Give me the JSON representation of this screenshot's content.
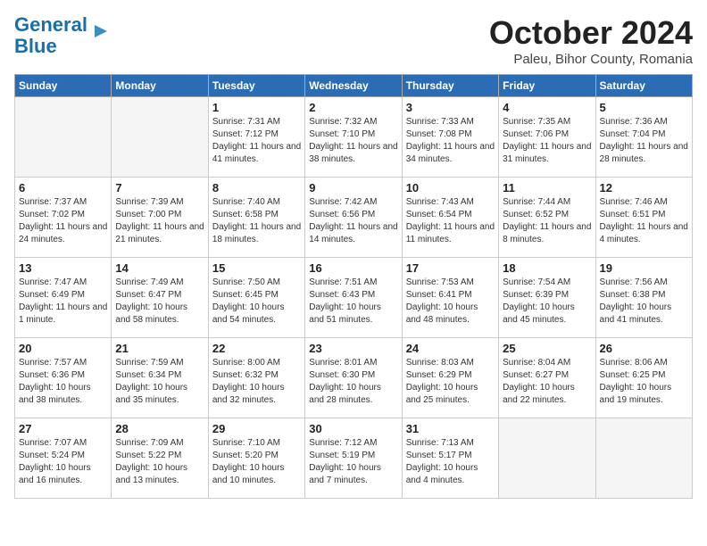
{
  "header": {
    "logo_general": "General",
    "logo_blue": "Blue",
    "month": "October 2024",
    "location": "Paleu, Bihor County, Romania"
  },
  "days_of_week": [
    "Sunday",
    "Monday",
    "Tuesday",
    "Wednesday",
    "Thursday",
    "Friday",
    "Saturday"
  ],
  "weeks": [
    [
      {
        "day": "",
        "content": ""
      },
      {
        "day": "",
        "content": ""
      },
      {
        "day": "1",
        "content": "Sunrise: 7:31 AM\nSunset: 7:12 PM\nDaylight: 11 hours and 41 minutes."
      },
      {
        "day": "2",
        "content": "Sunrise: 7:32 AM\nSunset: 7:10 PM\nDaylight: 11 hours and 38 minutes."
      },
      {
        "day": "3",
        "content": "Sunrise: 7:33 AM\nSunset: 7:08 PM\nDaylight: 11 hours and 34 minutes."
      },
      {
        "day": "4",
        "content": "Sunrise: 7:35 AM\nSunset: 7:06 PM\nDaylight: 11 hours and 31 minutes."
      },
      {
        "day": "5",
        "content": "Sunrise: 7:36 AM\nSunset: 7:04 PM\nDaylight: 11 hours and 28 minutes."
      }
    ],
    [
      {
        "day": "6",
        "content": "Sunrise: 7:37 AM\nSunset: 7:02 PM\nDaylight: 11 hours and 24 minutes."
      },
      {
        "day": "7",
        "content": "Sunrise: 7:39 AM\nSunset: 7:00 PM\nDaylight: 11 hours and 21 minutes."
      },
      {
        "day": "8",
        "content": "Sunrise: 7:40 AM\nSunset: 6:58 PM\nDaylight: 11 hours and 18 minutes."
      },
      {
        "day": "9",
        "content": "Sunrise: 7:42 AM\nSunset: 6:56 PM\nDaylight: 11 hours and 14 minutes."
      },
      {
        "day": "10",
        "content": "Sunrise: 7:43 AM\nSunset: 6:54 PM\nDaylight: 11 hours and 11 minutes."
      },
      {
        "day": "11",
        "content": "Sunrise: 7:44 AM\nSunset: 6:52 PM\nDaylight: 11 hours and 8 minutes."
      },
      {
        "day": "12",
        "content": "Sunrise: 7:46 AM\nSunset: 6:51 PM\nDaylight: 11 hours and 4 minutes."
      }
    ],
    [
      {
        "day": "13",
        "content": "Sunrise: 7:47 AM\nSunset: 6:49 PM\nDaylight: 11 hours and 1 minute."
      },
      {
        "day": "14",
        "content": "Sunrise: 7:49 AM\nSunset: 6:47 PM\nDaylight: 10 hours and 58 minutes."
      },
      {
        "day": "15",
        "content": "Sunrise: 7:50 AM\nSunset: 6:45 PM\nDaylight: 10 hours and 54 minutes."
      },
      {
        "day": "16",
        "content": "Sunrise: 7:51 AM\nSunset: 6:43 PM\nDaylight: 10 hours and 51 minutes."
      },
      {
        "day": "17",
        "content": "Sunrise: 7:53 AM\nSunset: 6:41 PM\nDaylight: 10 hours and 48 minutes."
      },
      {
        "day": "18",
        "content": "Sunrise: 7:54 AM\nSunset: 6:39 PM\nDaylight: 10 hours and 45 minutes."
      },
      {
        "day": "19",
        "content": "Sunrise: 7:56 AM\nSunset: 6:38 PM\nDaylight: 10 hours and 41 minutes."
      }
    ],
    [
      {
        "day": "20",
        "content": "Sunrise: 7:57 AM\nSunset: 6:36 PM\nDaylight: 10 hours and 38 minutes."
      },
      {
        "day": "21",
        "content": "Sunrise: 7:59 AM\nSunset: 6:34 PM\nDaylight: 10 hours and 35 minutes."
      },
      {
        "day": "22",
        "content": "Sunrise: 8:00 AM\nSunset: 6:32 PM\nDaylight: 10 hours and 32 minutes."
      },
      {
        "day": "23",
        "content": "Sunrise: 8:01 AM\nSunset: 6:30 PM\nDaylight: 10 hours and 28 minutes."
      },
      {
        "day": "24",
        "content": "Sunrise: 8:03 AM\nSunset: 6:29 PM\nDaylight: 10 hours and 25 minutes."
      },
      {
        "day": "25",
        "content": "Sunrise: 8:04 AM\nSunset: 6:27 PM\nDaylight: 10 hours and 22 minutes."
      },
      {
        "day": "26",
        "content": "Sunrise: 8:06 AM\nSunset: 6:25 PM\nDaylight: 10 hours and 19 minutes."
      }
    ],
    [
      {
        "day": "27",
        "content": "Sunrise: 7:07 AM\nSunset: 5:24 PM\nDaylight: 10 hours and 16 minutes."
      },
      {
        "day": "28",
        "content": "Sunrise: 7:09 AM\nSunset: 5:22 PM\nDaylight: 10 hours and 13 minutes."
      },
      {
        "day": "29",
        "content": "Sunrise: 7:10 AM\nSunset: 5:20 PM\nDaylight: 10 hours and 10 minutes."
      },
      {
        "day": "30",
        "content": "Sunrise: 7:12 AM\nSunset: 5:19 PM\nDaylight: 10 hours and 7 minutes."
      },
      {
        "day": "31",
        "content": "Sunrise: 7:13 AM\nSunset: 5:17 PM\nDaylight: 10 hours and 4 minutes."
      },
      {
        "day": "",
        "content": ""
      },
      {
        "day": "",
        "content": ""
      }
    ]
  ]
}
